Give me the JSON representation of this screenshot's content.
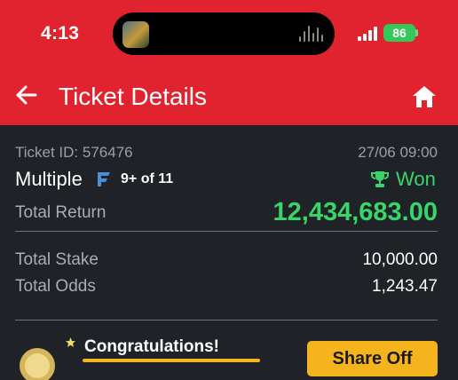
{
  "status_bar": {
    "time": "4:13",
    "battery": "86",
    "island_art_icon": "album-art",
    "waveform_icon": "audio-waveform-icon",
    "signal_icon": "cellular-signal-icon"
  },
  "header": {
    "title": "Ticket Details",
    "back_icon": "arrow-left-icon",
    "home_icon": "home-icon",
    "background": "#e0232e"
  },
  "ticket": {
    "id_label": "Ticket ID:",
    "id_value": "576476",
    "datetime": "27/06 09:00",
    "type": "Multiple",
    "type_icon": "flexi-icon",
    "selection_info": "9+ of 11",
    "status": "Won",
    "status_icon": "trophy-icon",
    "status_color": "#39d56b",
    "total_return_label": "Total Return",
    "total_return_value": "12,434,683.00",
    "total_stake_label": "Total Stake",
    "total_stake_value": "10,000.00",
    "total_odds_label": "Total Odds",
    "total_odds_value": "1,243.47"
  },
  "promo": {
    "title": "Congratulations!",
    "button_label": "Share Off",
    "accent": "#f5b31c",
    "coin_icon": "coin-icon",
    "star_icon": "star-icon"
  }
}
